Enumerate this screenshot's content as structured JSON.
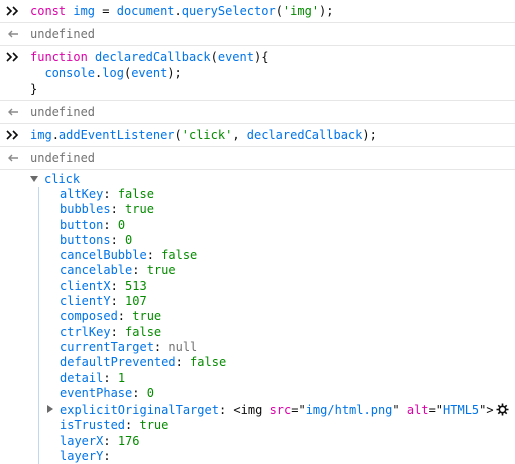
{
  "entries": [
    {
      "kind": "input",
      "tokens": [
        {
          "t": "const ",
          "c": "kw"
        },
        {
          "t": "img",
          "c": "id"
        },
        {
          "t": " = ",
          "c": "plain"
        },
        {
          "t": "document",
          "c": "id"
        },
        {
          "t": ".",
          "c": "plain"
        },
        {
          "t": "querySelector",
          "c": "fn"
        },
        {
          "t": "(",
          "c": "plain"
        },
        {
          "t": "'img'",
          "c": "str"
        },
        {
          "t": ");",
          "c": "plain"
        }
      ]
    },
    {
      "kind": "output",
      "text": "undefined"
    },
    {
      "kind": "input",
      "lines": [
        [
          {
            "t": "function ",
            "c": "kw"
          },
          {
            "t": "declaredCallback",
            "c": "id"
          },
          {
            "t": "(",
            "c": "plain"
          },
          {
            "t": "event",
            "c": "id"
          },
          {
            "t": "){",
            "c": "plain"
          }
        ],
        [
          {
            "t": "  console",
            "c": "id"
          },
          {
            "t": ".",
            "c": "plain"
          },
          {
            "t": "log",
            "c": "fn"
          },
          {
            "t": "(",
            "c": "plain"
          },
          {
            "t": "event",
            "c": "id"
          },
          {
            "t": ");",
            "c": "plain"
          }
        ],
        [
          {
            "t": "}",
            "c": "plain"
          }
        ]
      ]
    },
    {
      "kind": "output",
      "text": "undefined"
    },
    {
      "kind": "input",
      "tokens": [
        {
          "t": "img",
          "c": "id"
        },
        {
          "t": ".",
          "c": "plain"
        },
        {
          "t": "addEventListener",
          "c": "fn"
        },
        {
          "t": "(",
          "c": "plain"
        },
        {
          "t": "'click'",
          "c": "str"
        },
        {
          "t": ", ",
          "c": "plain"
        },
        {
          "t": "declaredCallback",
          "c": "id"
        },
        {
          "t": ");",
          "c": "plain"
        }
      ]
    },
    {
      "kind": "output",
      "text": "undefined"
    }
  ],
  "event_object": {
    "title": "click",
    "props": [
      {
        "key": "altKey",
        "value": "false",
        "type": "false"
      },
      {
        "key": "bubbles",
        "value": "true",
        "type": "true"
      },
      {
        "key": "button",
        "value": "0",
        "type": "num"
      },
      {
        "key": "buttons",
        "value": "0",
        "type": "num"
      },
      {
        "key": "cancelBubble",
        "value": "false",
        "type": "false"
      },
      {
        "key": "cancelable",
        "value": "true",
        "type": "true"
      },
      {
        "key": "clientX",
        "value": "513",
        "type": "num"
      },
      {
        "key": "clientY",
        "value": "107",
        "type": "num"
      },
      {
        "key": "composed",
        "value": "true",
        "type": "true"
      },
      {
        "key": "ctrlKey",
        "value": "false",
        "type": "false"
      },
      {
        "key": "currentTarget",
        "value": "null",
        "type": "null"
      },
      {
        "key": "defaultPrevented",
        "value": "false",
        "type": "false"
      },
      {
        "key": "detail",
        "value": "1",
        "type": "num"
      },
      {
        "key": "eventPhase",
        "value": "0",
        "type": "num"
      },
      {
        "key": "explicitOriginalTarget",
        "type": "element",
        "expandable": true,
        "tag": "img",
        "attrs": [
          {
            "name": "src",
            "value": "img/html.png"
          },
          {
            "name": "alt",
            "value": "HTML5"
          }
        ]
      },
      {
        "key": "isTrusted",
        "value": "true",
        "type": "true"
      },
      {
        "key": "layerX",
        "value": "176",
        "type": "num"
      },
      {
        "key": "layerY",
        "value": "",
        "type": "num"
      }
    ]
  },
  "icons": {
    "input_prompt": "double-chevron-right-icon",
    "output_return": "return-arrow-icon",
    "inspect": "gear-icon"
  },
  "colors": {
    "keyword": "#dd00a9",
    "identifier": "#0074e8",
    "string": "#058b00",
    "muted": "#737373",
    "guide": "#c0d8ef"
  }
}
